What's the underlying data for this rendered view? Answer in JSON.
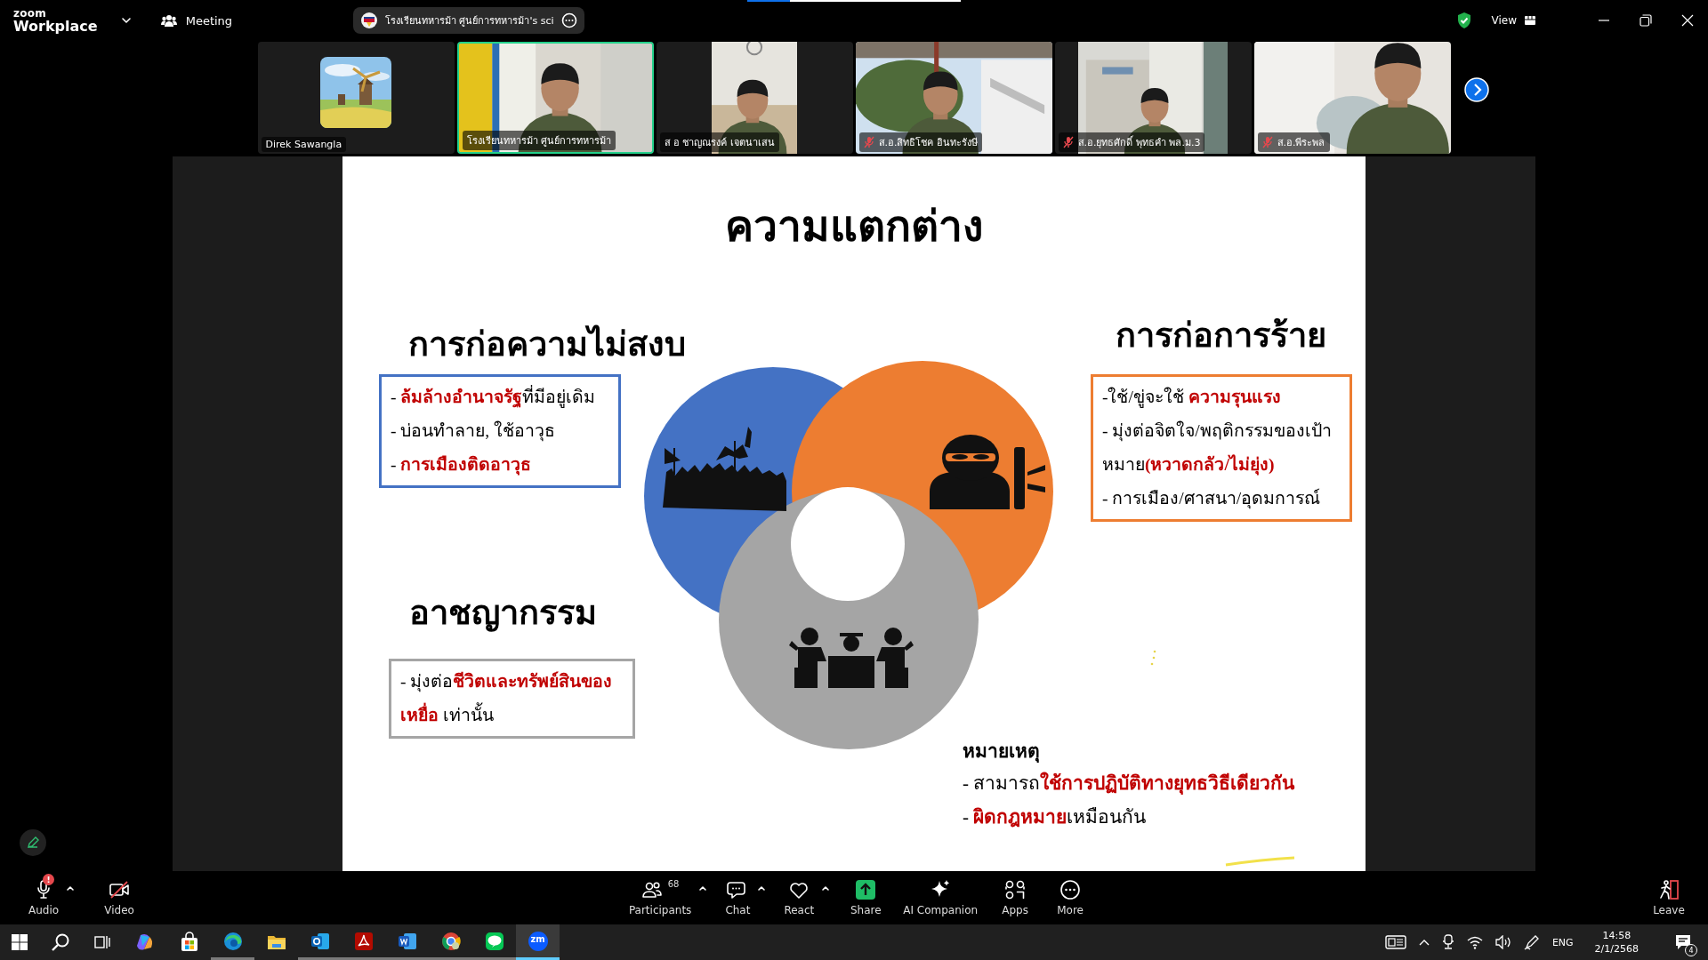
{
  "app": {
    "logo": "zoom",
    "product": "Workplace",
    "menu": "Meeting"
  },
  "window": {
    "title": "โรงเรียนทหารม้า ศูนย์การทหารม้า's sci",
    "view_label": "View"
  },
  "participants": [
    {
      "name": "Direk Sawangla",
      "kind": "avatar",
      "speaking": false,
      "muted": false
    },
    {
      "name": "โรงเรียนทหารม้า ศูนย์การทหารม้า",
      "kind": "video",
      "speaking": true,
      "muted": false
    },
    {
      "name": "ส อ ชาญณรงค์ เจตนาเสน",
      "kind": "portrait",
      "speaking": false,
      "muted": false
    },
    {
      "name": "ส.อ.สิทธิโชค อินทะรังษี",
      "kind": "video",
      "speaking": false,
      "muted": true
    },
    {
      "name": "ส.อ.ยุทธศักดิ์ พุทธคำ พล.ม.3",
      "kind": "portrait",
      "speaking": false,
      "muted": true
    },
    {
      "name": "ส.อ.พีระพล",
      "kind": "video",
      "speaking": false,
      "muted": true
    }
  ],
  "slide": {
    "title": "ความแตกต่าง",
    "sections": [
      {
        "heading": "การก่อความไม่สงบ",
        "color": "#4472c4",
        "lines": [
          "- **ล้มล้างอำนาจรัฐ**ที่มีอยู่เดิม",
          "- บ่อนทำลาย, ใช้อาวุธ",
          "- **การเมืองติดอาวุธ**"
        ]
      },
      {
        "heading": "การก่อการร้าย",
        "color": "#ed7d31",
        "lines": [
          "-ใช้/ขู่จะใช้ **ความรุนแรง**",
          "- มุ่งต่อจิตใจ/พฤติกรรมของเป้าหมาย**(หวาดกลัว/ไม่ยุ่ง)**",
          "- การเมือง/ศาสนา/อุดมการณ์"
        ]
      },
      {
        "heading": "อาชญากรรม",
        "color": "#a5a5a5",
        "lines": [
          "- มุ่งต่อ**ชีวิตและทรัพย์สินของเหยื่อ** เท่านั้น"
        ]
      }
    ],
    "note": {
      "heading": "หมายเหตุ",
      "lines": [
        "- สามารถ**ใช้การปฏิบัติทางยุทธวิธีเดียวกัน**",
        "- **ผิดกฎหมาย**เหมือนกัน"
      ]
    }
  },
  "toolbar": {
    "left": [
      {
        "label": "Audio",
        "badge": "!",
        "has_menu": true,
        "off": false
      },
      {
        "label": "Video",
        "has_menu": false,
        "off": true
      }
    ],
    "center": [
      {
        "label": "Participants",
        "count": "68",
        "has_menu": true,
        "off": false
      },
      {
        "label": "Chat",
        "has_menu": true,
        "off": false
      },
      {
        "label": "React",
        "has_menu": true,
        "off": false
      },
      {
        "label": "Share",
        "has_menu": false,
        "off": false
      },
      {
        "label": "AI Companion",
        "has_menu": false,
        "off": false
      },
      {
        "label": "Apps",
        "has_menu": false,
        "off": false
      },
      {
        "label": "More",
        "has_menu": false,
        "off": false
      }
    ],
    "leave": {
      "label": "Leave"
    }
  },
  "taskbar": {
    "apps": [
      {
        "running": false,
        "selected": false
      },
      {
        "running": false,
        "selected": false
      },
      {
        "running": true,
        "selected": false
      },
      {
        "running": false,
        "selected": false
      },
      {
        "running": true,
        "selected": false
      },
      {
        "running": true,
        "selected": false
      },
      {
        "running": true,
        "selected": false
      },
      {
        "running": true,
        "selected": false
      },
      {
        "running": true,
        "selected": false
      },
      {
        "running": true,
        "selected": true,
        "label": "zm"
      }
    ],
    "language": "ENG",
    "time": "14:58",
    "date": "2/1/2568",
    "notifications": "4"
  }
}
